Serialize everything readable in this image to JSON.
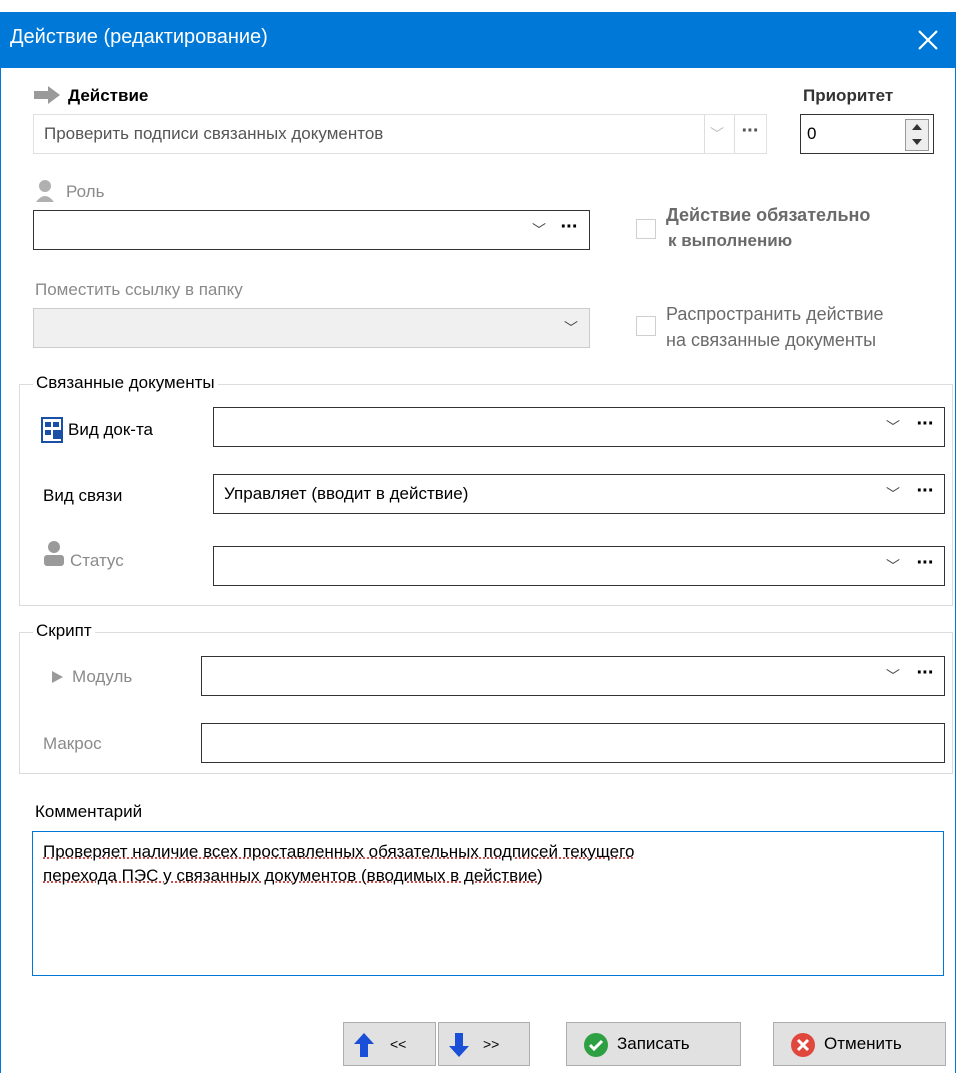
{
  "window": {
    "title": "Действие (редактирование)"
  },
  "action": {
    "label": "Действие",
    "value": "Проверить подписи связанных документов"
  },
  "priority": {
    "label": "Приоритет",
    "value": "0"
  },
  "role": {
    "label": "Роль",
    "value": ""
  },
  "mandatory": {
    "label_line1": "Действие обязательно",
    "label_line2": "к выполнению",
    "checked": false
  },
  "folder": {
    "label": "Поместить ссылку в папку",
    "value": ""
  },
  "propagate": {
    "label_line1": "Распространить действие",
    "label_line2": "на связанные документы",
    "checked": false
  },
  "related": {
    "title": "Связанные документы",
    "doc_type": {
      "label": "Вид док-та",
      "value": ""
    },
    "link_type": {
      "label": "Вид связи",
      "value": "Управляет (вводит в действие)"
    },
    "status": {
      "label": "Статус",
      "value": ""
    }
  },
  "script": {
    "title": "Скрипт",
    "module": {
      "label": "Модуль",
      "value": ""
    },
    "macro": {
      "label": "Макрос",
      "value": ""
    }
  },
  "comment": {
    "label": "Комментарий",
    "line1": "Проверяет наличие всех проставленных обязательных подписей текущего",
    "line2": "перехода ПЭС у связанных документов (вводимых в действие)"
  },
  "buttons": {
    "prev": "<<",
    "next": ">>",
    "save": "Записать",
    "cancel": "Отменить"
  },
  "icons": {
    "action": "arrow-right-icon",
    "role": "person-bust-icon",
    "doc_type": "document-list-icon",
    "status": "person-icon",
    "module": "play-triangle-icon",
    "prev": "arrow-up-icon",
    "next": "arrow-down-icon",
    "save": "check-circle-icon",
    "cancel": "x-circle-icon"
  },
  "colors": {
    "title_bar": "#0078d7",
    "save_icon": "#2ea043",
    "cancel_icon": "#e0483e",
    "arrows": "#1a4fd8"
  }
}
